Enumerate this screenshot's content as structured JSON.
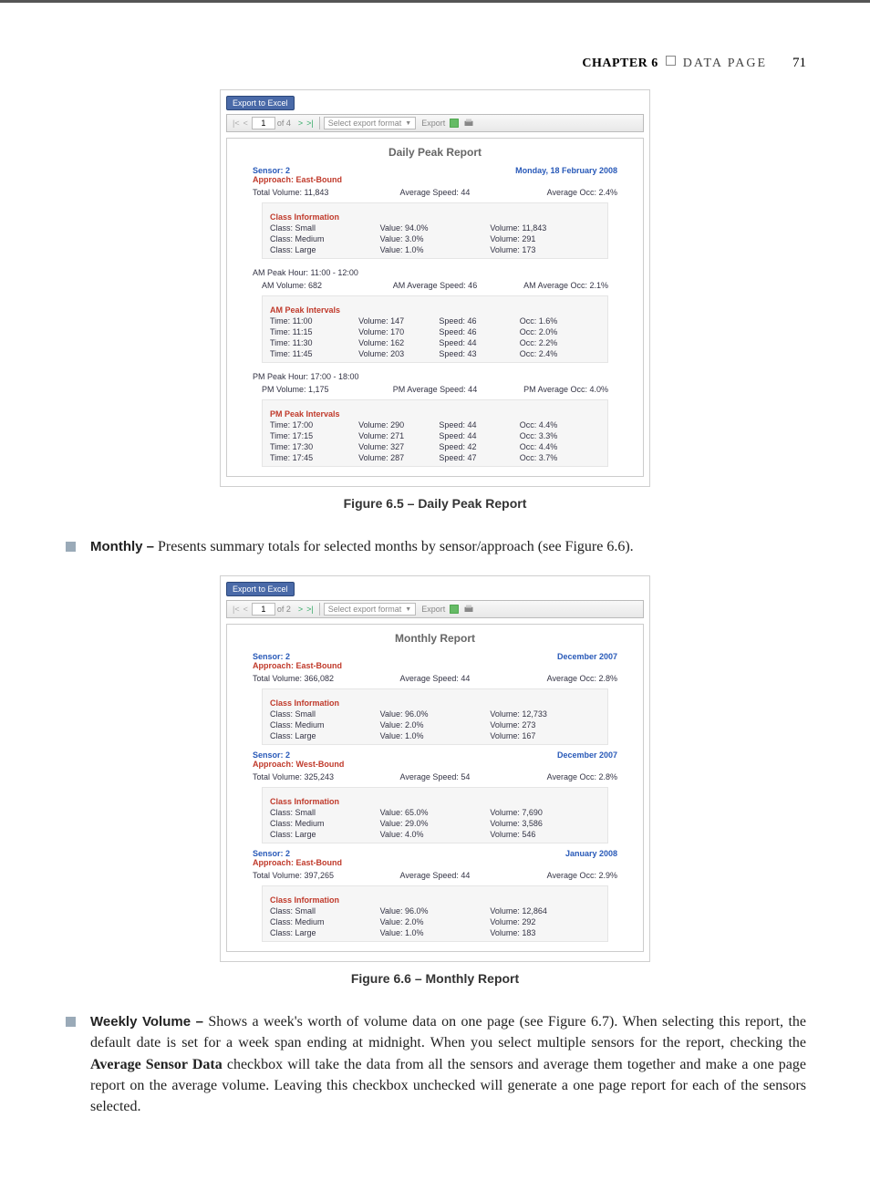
{
  "header": {
    "chapter": "CHAPTER 6",
    "title": "DATA PAGE",
    "pageNumber": "71"
  },
  "figure1": {
    "exportButton": "Export to Excel",
    "toolbar": {
      "page": "1",
      "ofLabel": "of 4",
      "formatLabel": "Select export format",
      "exportLabel": "Export"
    },
    "reportTitle": "Daily Peak Report",
    "sensorLabel": "Sensor: 2",
    "approachLabel": "Approach: East-Bound",
    "dateLabel": "Monday, 18 February 2008",
    "totals": {
      "totalVolume": "Total Volume: 11,843",
      "avgSpeed": "Average Speed: 44",
      "avgOcc": "Average Occ: 2.4%"
    },
    "classHeader": "Class Information",
    "classes": [
      {
        "name": "Class: Small",
        "value": "Value: 94.0%",
        "vol": "Volume: 11,843"
      },
      {
        "name": "Class: Medium",
        "value": "Value: 3.0%",
        "vol": "Volume: 291"
      },
      {
        "name": "Class: Large",
        "value": "Value: 1.0%",
        "vol": "Volume: 173"
      }
    ],
    "amHeader": "AM Peak Hour: 11:00 - 12:00",
    "amTotals": {
      "vol": "AM Volume: 682",
      "spd": "AM Average Speed: 46",
      "occ": "AM Average Occ: 2.1%"
    },
    "amIntervalsHeader": "AM Peak Intervals",
    "amIntervals": [
      {
        "t": "Time: 11:00",
        "v": "Volume: 147",
        "s": "Speed: 46",
        "o": "Occ: 1.6%"
      },
      {
        "t": "Time: 11:15",
        "v": "Volume: 170",
        "s": "Speed: 46",
        "o": "Occ: 2.0%"
      },
      {
        "t": "Time: 11:30",
        "v": "Volume: 162",
        "s": "Speed: 44",
        "o": "Occ: 2.2%"
      },
      {
        "t": "Time: 11:45",
        "v": "Volume: 203",
        "s": "Speed: 43",
        "o": "Occ: 2.4%"
      }
    ],
    "pmHeader": "PM Peak Hour: 17:00 - 18:00",
    "pmTotals": {
      "vol": "PM Volume: 1,175",
      "spd": "PM Average Speed: 44",
      "occ": "PM Average Occ: 4.0%"
    },
    "pmIntervalsHeader": "PM Peak Intervals",
    "pmIntervals": [
      {
        "t": "Time: 17:00",
        "v": "Volume: 290",
        "s": "Speed: 44",
        "o": "Occ: 4.4%"
      },
      {
        "t": "Time: 17:15",
        "v": "Volume: 271",
        "s": "Speed: 44",
        "o": "Occ: 3.3%"
      },
      {
        "t": "Time: 17:30",
        "v": "Volume: 327",
        "s": "Speed: 42",
        "o": "Occ: 4.4%"
      },
      {
        "t": "Time: 17:45",
        "v": "Volume: 287",
        "s": "Speed: 47",
        "o": "Occ: 3.7%"
      }
    ],
    "caption": "Figure 6.5 – Daily Peak Report"
  },
  "para1": {
    "term": "Monthly –",
    "text": " Presents summary totals for selected months by sensor/approach (see Figure 6.6)."
  },
  "figure2": {
    "exportButton": "Export to Excel",
    "toolbar": {
      "page": "1",
      "ofLabel": "of 2",
      "formatLabel": "Select export format",
      "exportLabel": "Export"
    },
    "reportTitle": "Monthly Report",
    "blocks": [
      {
        "sensor": "Sensor: 2",
        "approach": "Approach: East-Bound",
        "date": "December 2007",
        "totals": {
          "tv": "Total Volume: 366,082",
          "spd": "Average Speed: 44",
          "occ": "Average Occ: 2.8%"
        },
        "classHeader": "Class Information",
        "classes": [
          {
            "n": "Class: Small",
            "v": "Value: 96.0%",
            "vol": "Volume: 12,733"
          },
          {
            "n": "Class: Medium",
            "v": "Value: 2.0%",
            "vol": "Volume: 273"
          },
          {
            "n": "Class: Large",
            "v": "Value: 1.0%",
            "vol": "Volume: 167"
          }
        ]
      },
      {
        "sensor": "Sensor: 2",
        "approach": "Approach: West-Bound",
        "date": "December 2007",
        "totals": {
          "tv": "Total Volume: 325,243",
          "spd": "Average Speed: 54",
          "occ": "Average Occ: 2.8%"
        },
        "classHeader": "Class Information",
        "classes": [
          {
            "n": "Class: Small",
            "v": "Value: 65.0%",
            "vol": "Volume: 7,690"
          },
          {
            "n": "Class: Medium",
            "v": "Value: 29.0%",
            "vol": "Volume: 3,586"
          },
          {
            "n": "Class: Large",
            "v": "Value: 4.0%",
            "vol": "Volume: 546"
          }
        ]
      },
      {
        "sensor": "Sensor: 2",
        "approach": "Approach: East-Bound",
        "date": "January 2008",
        "totals": {
          "tv": "Total Volume: 397,265",
          "spd": "Average Speed: 44",
          "occ": "Average Occ: 2.9%"
        },
        "classHeader": "Class Information",
        "classes": [
          {
            "n": "Class: Small",
            "v": "Value: 96.0%",
            "vol": "Volume: 12,864"
          },
          {
            "n": "Class: Medium",
            "v": "Value: 2.0%",
            "vol": "Volume: 292"
          },
          {
            "n": "Class: Large",
            "v": "Value: 1.0%",
            "vol": "Volume: 183"
          }
        ]
      }
    ],
    "caption": "Figure 6.6 – Monthly Report"
  },
  "para2": {
    "term": "Weekly Volume –",
    "text1": " Shows a week's worth of volume data on one page (see Figure 6.7). When selecting this report, the default date is set for a week span ending at midnight. When you select multiple sensors for the report, checking the ",
    "bold": "Average Sensor Data",
    "text2": " checkbox will take the data from all the sensors and average them together and make a one page report on the average volume. Leaving this checkbox unchecked will generate a one page report for each of the sensors selected."
  }
}
